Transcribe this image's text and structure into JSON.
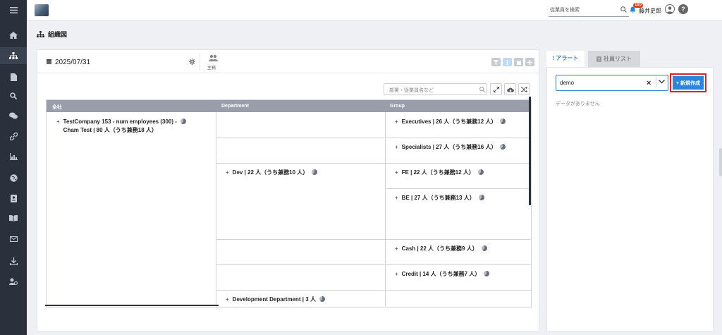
{
  "header": {
    "employee_search_placeholder": "従業員を検索",
    "notification_count": "193",
    "user_name": "藤井史郎",
    "help_label": "?"
  },
  "page": {
    "title": "組織図"
  },
  "toolbar": {
    "date": "2025/07/31",
    "primary_label": "主務",
    "search_placeholder": "部署・従業員名など"
  },
  "org_chart": {
    "headers": [
      "全社",
      "Department",
      "Group"
    ],
    "company": {
      "line1": "TestCompany 153 - num employees (300) -",
      "line2": "Cham Test | 80 人（うち兼務18 人）"
    },
    "departments": [
      {
        "label": "Dev | 22 人（うち兼務10 人）"
      },
      {
        "label": "Development Department | 3 人"
      }
    ],
    "groups": [
      {
        "label": "Executives | 26 人（うち兼務12 人）"
      },
      {
        "label": "Specialists | 27 人（うち兼務16 人）"
      },
      {
        "label": "FE | 22 人（うち兼務12 人）"
      },
      {
        "label": "BE | 27 人（うち兼務13 人）"
      },
      {
        "label": "Cash | 22 人（うち兼務9 人）"
      },
      {
        "label": "Credit | 14 人（うち兼務7 人）"
      }
    ]
  },
  "right_panel": {
    "tabs": [
      {
        "label": "! アラート"
      },
      {
        "label": "社員リスト"
      }
    ],
    "input_value": "demo",
    "new_button_label": "+ 新規作成",
    "empty_text": "データがありません"
  },
  "colors": {
    "sidebar_bg": "#2a303c",
    "accent_blue": "#2b86d9",
    "highlight_red": "#e02020",
    "table_header": "#9a9eab"
  }
}
